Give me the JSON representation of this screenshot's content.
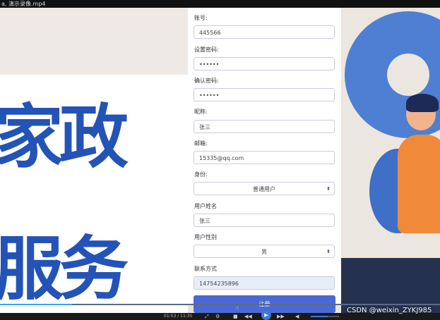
{
  "window": {
    "title": "a, 演示录像.mp4"
  },
  "background": {
    "headline_line1": "家政",
    "headline_line2": "服务"
  },
  "form": {
    "account_label": "账号:",
    "account_value": "445566",
    "password_label": "设置密码:",
    "password_value": "••••••",
    "confirm_label": "确认密码:",
    "confirm_value": "••••••",
    "nickname_label": "昵称:",
    "nickname_value": "张三",
    "email_label": "邮箱:",
    "email_value": "15335@qq.com",
    "identity_label": "身份:",
    "identity_selected": "普通用户",
    "realname_label": "用户姓名",
    "realname_value": "张三",
    "gender_label": "用户性别",
    "gender_selected": "男",
    "contact_label": "联系方式",
    "contact_value": "14754235896",
    "register_label": "注册"
  },
  "player": {
    "time": "01:53 / 11:35",
    "progress_fraction": 0.163
  },
  "watermark": "CSDN @weixin_ZYKJ985",
  "colors": {
    "brand_blue": "#2453b8",
    "button_blue": "#4b69d6"
  }
}
